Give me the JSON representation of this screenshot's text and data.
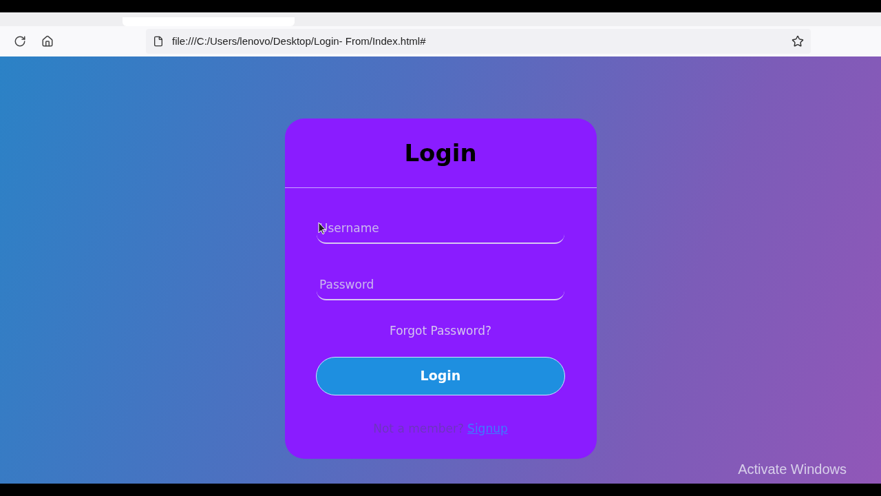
{
  "browser": {
    "address": "file:///C:/Users/lenovo/Desktop/Login- From/Index.html#"
  },
  "login_card": {
    "title": "Login",
    "fields": [
      {
        "placeholder": "Username"
      },
      {
        "placeholder": "Password"
      }
    ],
    "forgot_link": "Forgot Password?",
    "submit_button": "Login",
    "signup_prompt": "Not a member?",
    "signup_link": "Signup"
  },
  "os_watermark": "Activate Windows"
}
